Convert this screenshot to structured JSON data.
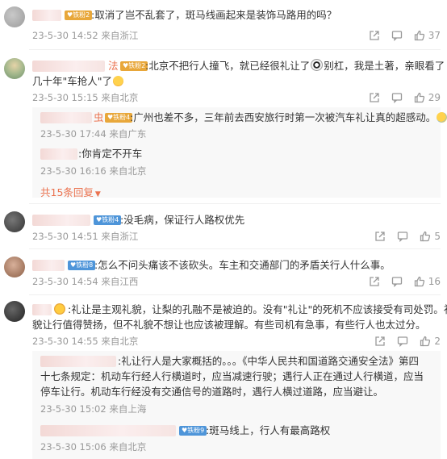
{
  "comments": [
    {
      "badge": "铁粉2",
      "text": ":取消了岂不乱套了，斑马线画起来是装饰马路用的吗？",
      "time": "23-5-30 14:52 来自浙江",
      "likes": "37"
    },
    {
      "name_suffix": "法",
      "badge": "铁粉2",
      "text_a": ":北京不把行人撞飞，就已经很礼让了",
      "text_b": "别杠，我是土著，亲眼看了",
      "text_c": "几十年\"车抢人\"了",
      "time": "23-5-30 15:15 来自北京",
      "likes": "29",
      "replies": [
        {
          "name_suffix": "虫",
          "badge": "铁粉4",
          "text": ":广州也差不多，三年前去西安旅行时第一次被汽车礼让真的超感动。",
          "time": "23-5-30 17:44 来自广东"
        },
        {
          "text": ":你肯定不开车",
          "time": "23-5-30 16:16 来自北京"
        }
      ],
      "more_replies": "共15条回复"
    },
    {
      "badge": "铁粉4",
      "text": ":没毛病，保证行人路权优先",
      "time": "23-5-30 14:51 来自浙江",
      "likes": "5"
    },
    {
      "badge": "铁粉8",
      "text": ":怎么不问头痛该不该砍头。车主和交通部门的矛盾关行人什么事。",
      "time": "23-5-30 14:54 来自江西",
      "likes": "16"
    },
    {
      "text_line1": ":礼让是主观礼貌，让梨的孔融不是被迫的。没有\"礼让\"的死机不应该接受有司处罚。礼",
      "text_line2": "貌让行值得赞扬，但不礼貌不想让也应该被理解。有些司机有急事，有些行人也太过分。",
      "time": "23-5-30 14:55 来自北京",
      "likes": "2",
      "replies": [
        {
          "text": ":礼让行人是大家概括的。。。《中华人民共和国道路交通安全法》第四十七条规定：机动车行经人行横道时，应当减速行驶；遇行人正在通过人行横道，应当停车让行。机动车行经没有交通信号的道路时，遇行人横过道路，应当避让。",
          "time": "23-5-30 15:02 来自上海"
        },
        {
          "badge": "铁粉9",
          "text": ":斑马线上，行人有最高路权",
          "time": "23-5-30 15:06 来自北京"
        }
      ]
    }
  ],
  "colors": {
    "link": "#eb7350",
    "meta": "#999999",
    "badge_gold": "#e8a73a",
    "badge_blue": "#4e95d9"
  },
  "icons": [
    "share-icon",
    "comment-icon",
    "like-icon",
    "chevron-down-icon"
  ]
}
